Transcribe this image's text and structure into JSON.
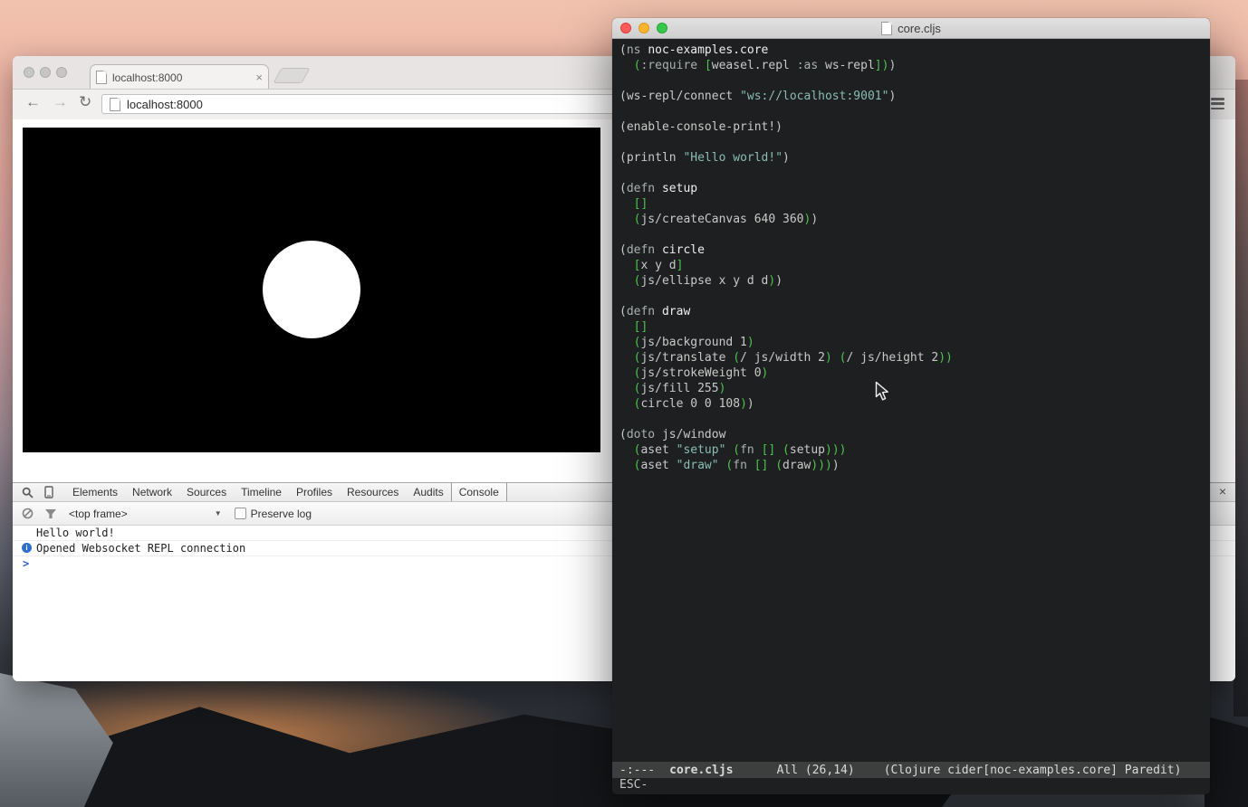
{
  "colors": {
    "paren_green": "#4dc34d",
    "string_teal": "#8abdb3",
    "editor_background": "#1d1f21",
    "canvas_background": "#000000",
    "canvas_circle": "#ffffff",
    "info_blue": "#2c6fce",
    "prompt_blue": "#2b59c3"
  },
  "browser": {
    "tab_title": "localhost:8000",
    "tab_close_symbol": "×",
    "url": "localhost:8000",
    "back_symbol": "←",
    "forward_symbol": "→",
    "reload_symbol": "↻"
  },
  "devtools": {
    "tabs": [
      "Elements",
      "Network",
      "Sources",
      "Timeline",
      "Profiles",
      "Resources",
      "Audits",
      "Console"
    ],
    "selected_tab": "Console",
    "frame_selector": "<top frame>",
    "dropdown_symbol": "▼",
    "preserve_log_label": "Preserve log",
    "console_lines": [
      {
        "type": "log",
        "text": "Hello world!"
      },
      {
        "type": "info",
        "text": "Opened Websocket REPL connection",
        "icon": "i"
      }
    ],
    "prompt_symbol": ">",
    "close_symbol": "×"
  },
  "editor": {
    "window_title": "core.cljs",
    "lines": [
      [
        [
          "t",
          "("
        ],
        [
          "k",
          "ns"
        ],
        [
          "t",
          " "
        ],
        [
          "b",
          "noc-examples.core"
        ]
      ],
      [
        [
          "t",
          "  "
        ],
        [
          "g",
          "("
        ],
        [
          "k",
          ":require"
        ],
        [
          "t",
          " "
        ],
        [
          "g",
          "["
        ],
        [
          "t",
          "weasel.repl "
        ],
        [
          "k",
          ":as"
        ],
        [
          "t",
          " ws-repl"
        ],
        [
          "g",
          "]"
        ],
        [
          "g",
          ")"
        ],
        [
          "t",
          ")"
        ]
      ],
      [],
      [
        [
          "t",
          "(ws-repl/connect "
        ],
        [
          "s",
          "\"ws://localhost:9001\""
        ],
        [
          "t",
          ")"
        ]
      ],
      [],
      [
        [
          "t",
          "(enable-console-print!)"
        ]
      ],
      [],
      [
        [
          "t",
          "(println "
        ],
        [
          "s",
          "\"Hello world!\""
        ],
        [
          "t",
          ")"
        ]
      ],
      [],
      [
        [
          "t",
          "("
        ],
        [
          "k",
          "defn"
        ],
        [
          "t",
          " "
        ],
        [
          "b",
          "setup"
        ]
      ],
      [
        [
          "t",
          "  "
        ],
        [
          "g",
          "[]"
        ]
      ],
      [
        [
          "t",
          "  "
        ],
        [
          "g",
          "("
        ],
        [
          "t",
          "js/createCanvas 640 360"
        ],
        [
          "g",
          ")"
        ],
        [
          "t",
          ")"
        ]
      ],
      [],
      [
        [
          "t",
          "("
        ],
        [
          "k",
          "defn"
        ],
        [
          "t",
          " "
        ],
        [
          "b",
          "circle"
        ]
      ],
      [
        [
          "t",
          "  "
        ],
        [
          "g",
          "["
        ],
        [
          "t",
          "x y d"
        ],
        [
          "g",
          "]"
        ]
      ],
      [
        [
          "t",
          "  "
        ],
        [
          "g",
          "("
        ],
        [
          "t",
          "js/ellipse x y d d"
        ],
        [
          "g",
          ")"
        ],
        [
          "t",
          ")"
        ]
      ],
      [],
      [
        [
          "t",
          "("
        ],
        [
          "k",
          "defn"
        ],
        [
          "t",
          " "
        ],
        [
          "b",
          "draw"
        ]
      ],
      [
        [
          "t",
          "  "
        ],
        [
          "g",
          "[]"
        ]
      ],
      [
        [
          "t",
          "  "
        ],
        [
          "g",
          "("
        ],
        [
          "t",
          "js/background 1"
        ],
        [
          "g",
          ")"
        ]
      ],
      [
        [
          "t",
          "  "
        ],
        [
          "g",
          "("
        ],
        [
          "t",
          "js/translate "
        ],
        [
          "g",
          "("
        ],
        [
          "t",
          "/ js/width 2"
        ],
        [
          "g",
          ")"
        ],
        [
          "t",
          " "
        ],
        [
          "g",
          "("
        ],
        [
          "t",
          "/ js/height 2"
        ],
        [
          "g",
          ")"
        ],
        [
          "g",
          ")"
        ]
      ],
      [
        [
          "t",
          "  "
        ],
        [
          "g",
          "("
        ],
        [
          "t",
          "js/strokeWeight 0"
        ],
        [
          "g",
          ")"
        ]
      ],
      [
        [
          "t",
          "  "
        ],
        [
          "g",
          "("
        ],
        [
          "t",
          "js/fill 255"
        ],
        [
          "g",
          ")"
        ]
      ],
      [
        [
          "t",
          "  "
        ],
        [
          "g",
          "("
        ],
        [
          "t",
          "circle 0 0 108"
        ],
        [
          "g",
          ")"
        ],
        [
          "t",
          ")"
        ]
      ],
      [],
      [
        [
          "t",
          "("
        ],
        [
          "k",
          "doto"
        ],
        [
          "t",
          " js/window"
        ]
      ],
      [
        [
          "t",
          "  "
        ],
        [
          "g",
          "("
        ],
        [
          "t",
          "aset "
        ],
        [
          "s",
          "\"setup\""
        ],
        [
          "t",
          " "
        ],
        [
          "g",
          "("
        ],
        [
          "k",
          "fn"
        ],
        [
          "t",
          " "
        ],
        [
          "g",
          "[]"
        ],
        [
          "t",
          " "
        ],
        [
          "g",
          "("
        ],
        [
          "t",
          "setup"
        ],
        [
          "g",
          ")"
        ],
        [
          "g",
          ")"
        ],
        [
          "g",
          ")"
        ]
      ],
      [
        [
          "t",
          "  "
        ],
        [
          "g",
          "("
        ],
        [
          "t",
          "aset "
        ],
        [
          "s",
          "\"draw\""
        ],
        [
          "t",
          " "
        ],
        [
          "g",
          "("
        ],
        [
          "k",
          "fn"
        ],
        [
          "t",
          " "
        ],
        [
          "g",
          "[]"
        ],
        [
          "t",
          " "
        ],
        [
          "g",
          "("
        ],
        [
          "t",
          "draw"
        ],
        [
          "g",
          ")"
        ],
        [
          "g",
          ")"
        ],
        [
          "g",
          ")"
        ],
        [
          "t",
          ")"
        ]
      ]
    ],
    "modeline": {
      "flags": "-:---",
      "buffer": "core.cljs",
      "position": "All (26,14)",
      "modes": "(Clojure cider[noc-examples.core] Paredit)"
    },
    "echo": "ESC-"
  }
}
